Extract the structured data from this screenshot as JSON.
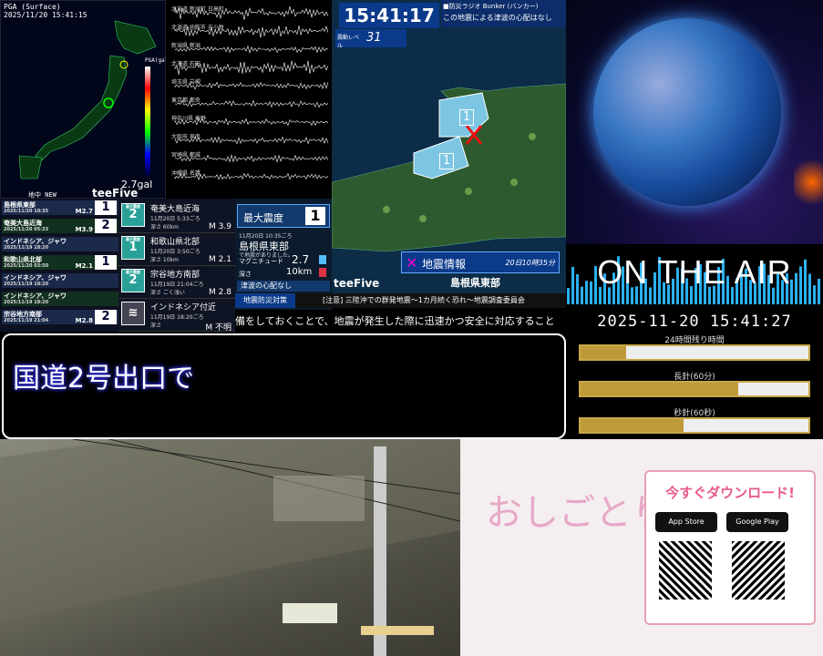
{
  "pga_map": {
    "title": "PGA (Surface)",
    "timestamp": "2025/11/20 15:41:15",
    "value": "2.7gal",
    "legend_title": "PGA(gal)",
    "footer": "地中 NEW",
    "brand": "teeFive"
  },
  "seismograph": {
    "stations": [
      "北海道 新冠町 日高町",
      "北海道 函館市 吉小牧",
      "新潟県 新潟",
      "北海道 石田",
      "埼玉県 岩槻",
      "東京都 都央",
      "神奈川県 秦野",
      "大阪府 泉南",
      "宮崎県 都城",
      "沖縄県 名護"
    ]
  },
  "eq_list": [
    {
      "name": "島根県東部",
      "date": "2025/11/20 10:35",
      "mag": "M2.7",
      "shindo": "1"
    },
    {
      "name": "奄美大島近海",
      "date": "2025/11/20 05:33",
      "mag": "M3.9",
      "shindo": "2"
    },
    {
      "name": "インドネシア、ジャワ",
      "date": "2025/11/19 18:20",
      "mag": "",
      "shindo": ""
    },
    {
      "name": "和歌山県北部",
      "date": "2025/11/20 03:50",
      "mag": "M2.1",
      "shindo": "1"
    },
    {
      "name": "インドネシア、ジャワ",
      "date": "2025/11/19 18:20",
      "mag": "",
      "shindo": ""
    },
    {
      "name": "インドネシア、ジャワ",
      "date": "2025/11/19 18:20",
      "mag": "",
      "shindo": ""
    },
    {
      "name": "宗谷地方南部",
      "date": "2025/11/19 21:04",
      "mag": "M2.8",
      "shindo": "2"
    }
  ],
  "eq_details": [
    {
      "label": "最大震度",
      "shindo": "2",
      "name": "奄美大島近海",
      "date": "11月20日 5:33ごろ",
      "depth": "深さ 60km",
      "mag": "M 3.9"
    },
    {
      "label": "最大震度",
      "shindo": "1",
      "name": "和歌山県北部",
      "date": "11月20日 3:50ごろ",
      "depth": "深さ 10km",
      "mag": "M 2.1"
    },
    {
      "label": "最大震度",
      "shindo": "2",
      "name": "宗谷地方南部",
      "date": "11月19日 21:04ごろ",
      "depth": "深さ ごく浅い",
      "mag": "M 2.8"
    },
    {
      "label": "",
      "shindo": "",
      "name": "インドネシア付近",
      "date": "11月19日 18:20ごろ",
      "depth": "深さ",
      "mag": "M 不明"
    }
  ],
  "info_panel": {
    "max_label": "最大震度",
    "max_value": "1",
    "date": "11月20日 10:35ごろ",
    "region": "島根県東部",
    "note": "で地震がありました。",
    "mag_label": "マグニチュード",
    "mag_value": "2.7",
    "depth_label": "深さ",
    "depth_value": "10km",
    "tsunami": "津波の心配なし"
  },
  "shimane": {
    "clock": "15:41:17",
    "bunker": "■防災ラジオ Bunker (バンカー)",
    "tsunami_note": "この地震による津波の心配はなし",
    "level_label": "震動レベル",
    "level_value": "31",
    "info_title": "地震情報",
    "info_time": "20日10時35分",
    "region": "島根県東部",
    "brand": "teeFive",
    "intensity_badges": [
      "1",
      "1"
    ]
  },
  "ticker": {
    "tag": "地震防災対策",
    "headline": "[注意] 三陸沖での群発地震～1カ月続く恐れ～地震調査委員会",
    "scroll": "備をしておくことで、地震が発生した際に迅速かつ安全に対応すること"
  },
  "banner": {
    "text": "国道2号出口で"
  },
  "onair": {
    "title": "ON THE AIR",
    "datetime": "2025-11-20 15:41:27",
    "bars": [
      {
        "label": "24時間残り時間",
        "fraction": 0.2
      },
      {
        "label": "長針(60分)",
        "fraction": 0.69
      },
      {
        "label": "秒針(60秒)",
        "fraction": 0.45
      }
    ]
  },
  "promo": {
    "logo": "おしごとりん",
    "headline": "今すぐダウンロード!",
    "app_store": "App Store",
    "google_play": "Google Play"
  }
}
